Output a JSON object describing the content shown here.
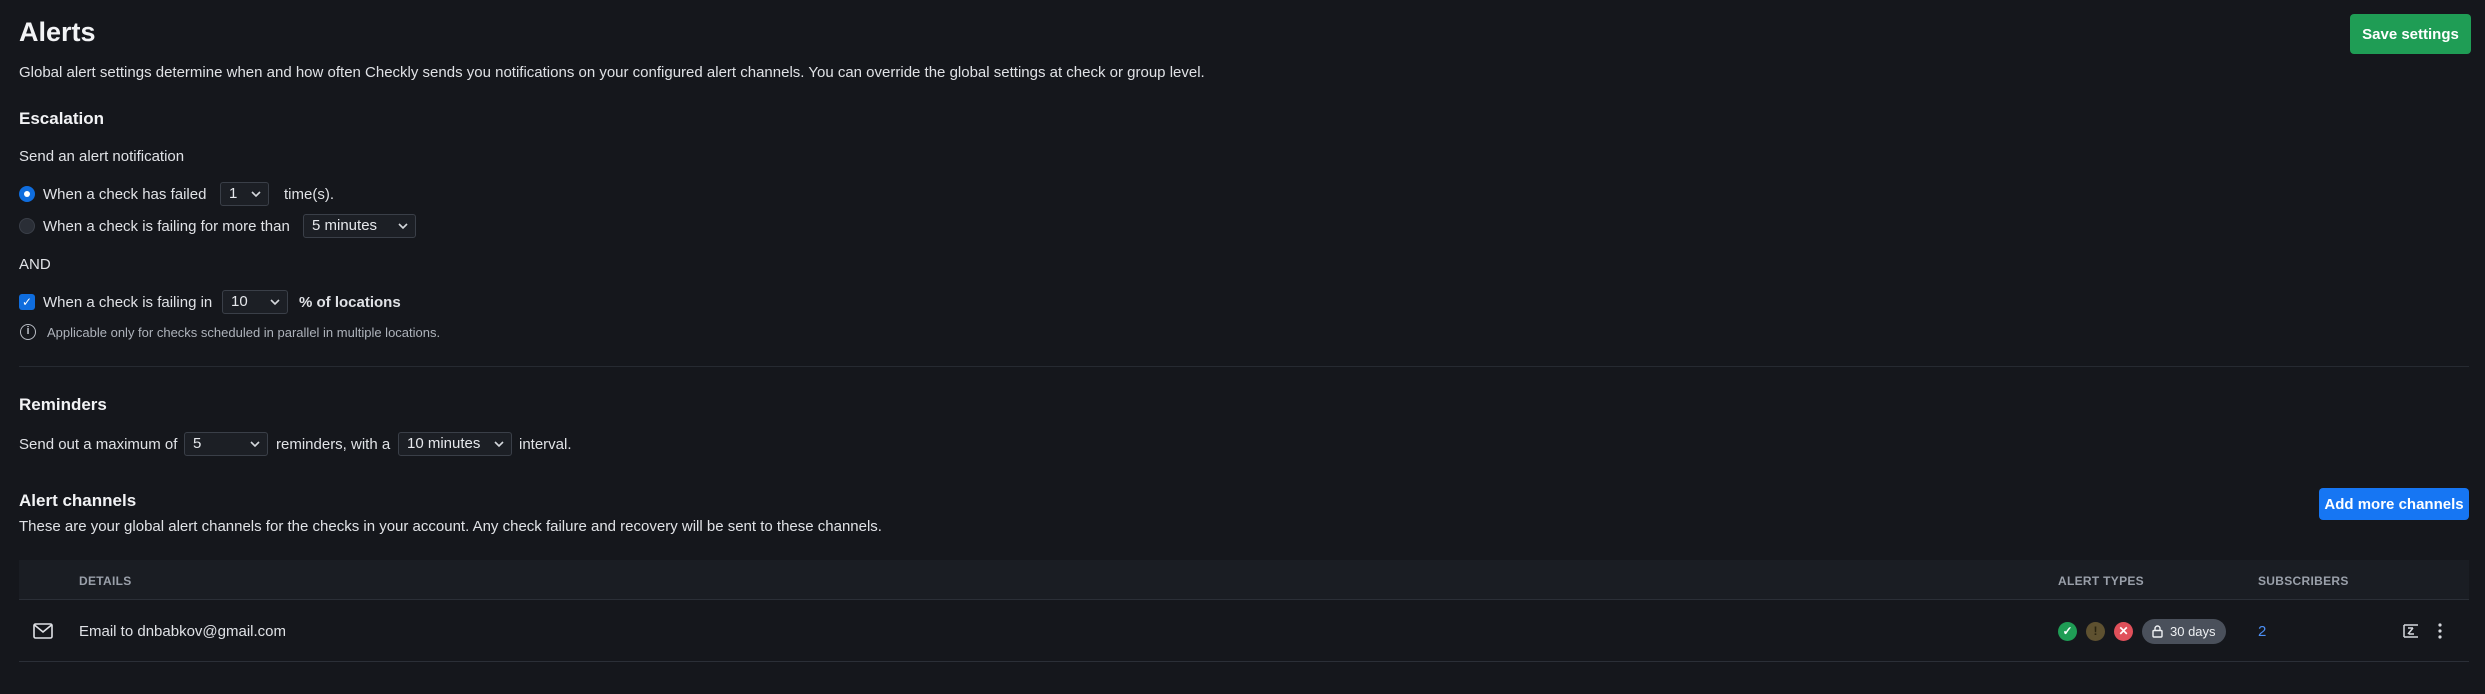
{
  "header": {
    "title": "Alerts",
    "save_label": "Save settings",
    "description": "Global alert settings determine when and how often Checkly sends you notifications on your configured alert channels. You can override the global settings at check or group level."
  },
  "escalation": {
    "heading": "Escalation",
    "intro": "Send an alert notification",
    "option_failed": {
      "label": "When a check has failed",
      "value": "1",
      "suffix": "time(s).",
      "selected": true
    },
    "option_failing_for": {
      "label": "When a check is failing for more than",
      "value": "5 minutes",
      "selected": false
    },
    "and_label": "AND",
    "locations": {
      "label": "When a check is failing in",
      "value": "10",
      "suffix": "% of locations",
      "checked": true
    },
    "note": "Applicable only for checks scheduled in parallel in multiple locations."
  },
  "reminders": {
    "heading": "Reminders",
    "prefix": "Send out a maximum of",
    "count": "5",
    "middle": "reminders, with a",
    "interval": "10 minutes",
    "suffix": "interval."
  },
  "channels": {
    "heading": "Alert channels",
    "description": "These are your global alert channels for the checks in your account. Any check failure and recovery will be sent to these channels.",
    "add_label": "Add more channels",
    "columns": {
      "details": "DETAILS",
      "alert_types": "ALERT TYPES",
      "subscribers": "SUBSCRIBERS"
    },
    "rows": [
      {
        "icon": "mail-icon",
        "details": "Email to dnbabkov@gmail.com",
        "retention": "30 days",
        "subscribers": "2"
      }
    ]
  },
  "colors": {
    "background": "#15171c",
    "save_button": "#1f9d55",
    "primary_button": "#1676f3",
    "recovery": "#1f9d55",
    "degraded": "#6b5a2c",
    "failure": "#e0505a",
    "link": "#4c8ff5"
  }
}
